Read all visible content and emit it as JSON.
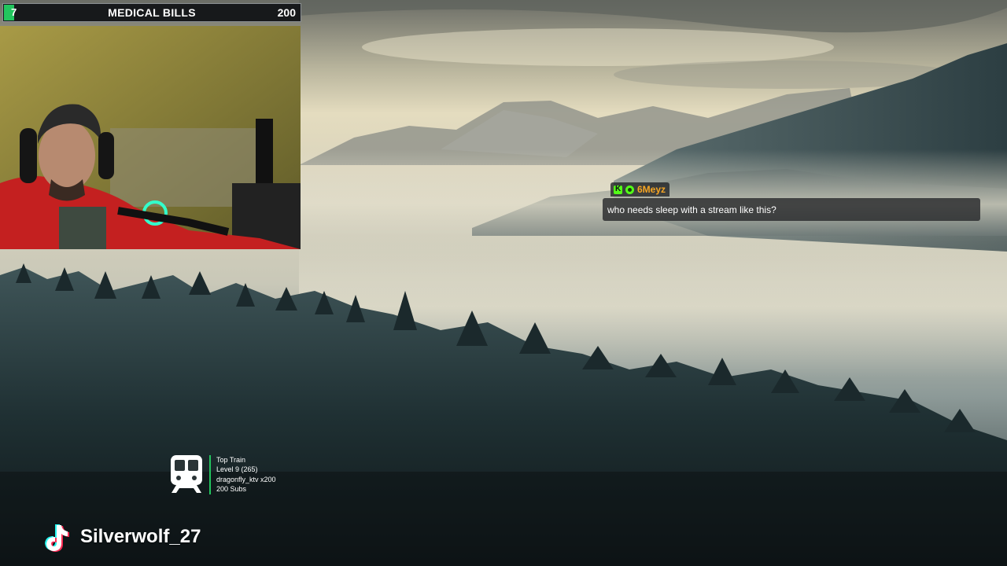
{
  "goal": {
    "current": "7",
    "title": "MEDICAL BILLS",
    "target": "200",
    "progress_fraction": 0.035,
    "fill_color": "#22c55e"
  },
  "chat": {
    "username": "6Meyz",
    "badges": [
      "kick-badge-icon",
      "subscriber-badge-icon"
    ],
    "message": "who needs sleep with a stream like this?",
    "username_color": "#f6a623"
  },
  "train": {
    "icon": "train-icon",
    "lines": [
      "Top Train",
      "Level 9  (265)",
      "dragonfly_ktv x200",
      "200 Subs"
    ],
    "accent": "#22c55e"
  },
  "social": {
    "icon": "tiktok-icon",
    "name": "Silverwolf_27"
  }
}
